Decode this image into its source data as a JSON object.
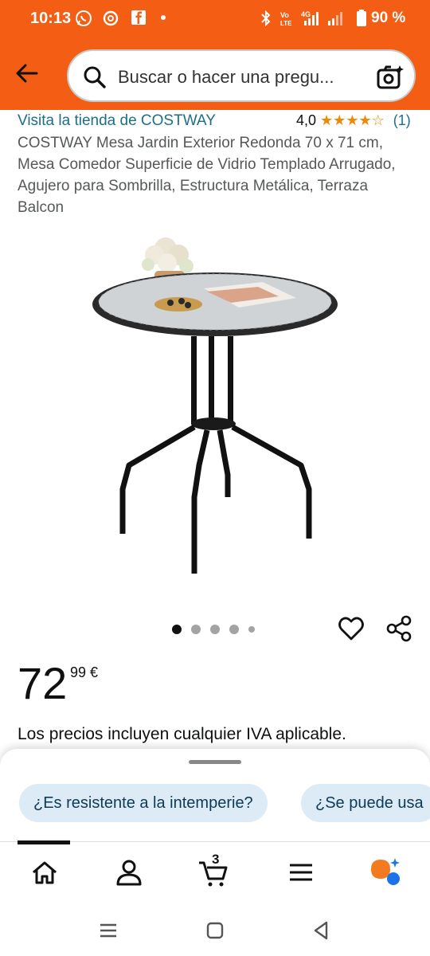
{
  "status_bar": {
    "time": "10:13",
    "battery": "90 %",
    "icons": [
      "whatsapp-icon",
      "threads-icon",
      "facebook-icon",
      "bluetooth-icon",
      "volte-icon",
      "4g-signal-icon",
      "battery-icon"
    ]
  },
  "header": {
    "search_placeholder": "Buscar o hacer una pregu..."
  },
  "product": {
    "store_link": "Visita la tienda de COSTWAY",
    "rating_value": "4,0",
    "stars": "★★★★☆",
    "rating_count": "(1)",
    "title": "COSTWAY Mesa Jardin Exterior Redonda 70 x 71 cm, Mesa Comedor Superficie de Vidrio Templado Arrugado, Agujero para Sombrilla, Estructura Metálica, Terraza Balcon",
    "image_count": 5,
    "active_image": 1,
    "price_integer": "72",
    "price_decimal": "99 €",
    "vat_note": "Los precios incluyen cualquier IVA aplicable."
  },
  "sheet": {
    "chips": [
      "¿Es resistente a la intemperie?",
      "¿Se puede usa"
    ]
  },
  "bottom_nav": {
    "cart_count": "3",
    "items": [
      "home-icon",
      "account-icon",
      "cart-icon",
      "menu-icon",
      "rufus-icon"
    ]
  },
  "colors": {
    "header": "#f45d14",
    "link": "#1c6f8a",
    "star": "#f08804",
    "chip": "#dcebf5"
  }
}
